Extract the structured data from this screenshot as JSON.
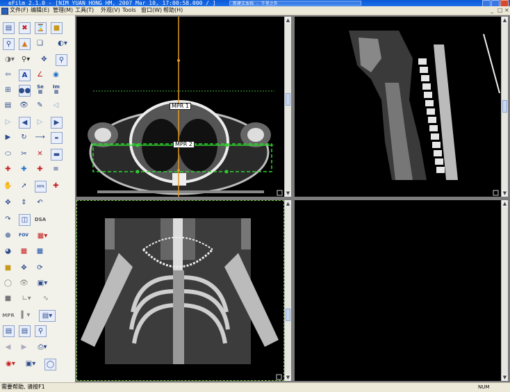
{
  "window": {
    "title": "eFilm 2.1.0 - [NIM YUAN HONG HM, 2007 Mar 10, 17:00:58.000 / ]",
    "taskbar_item": "新建文本档 - 千里之外"
  },
  "menu": {
    "items": [
      "文件(F)",
      "编辑(E)",
      "管理(M)",
      "工具(T)",
      "外观(V)",
      "Tools",
      "窗口(W)",
      "帮助(H)"
    ]
  },
  "toolbar": {
    "text_labels": {
      "series": "Se",
      "image": "Im",
      "fov": "FOV",
      "dsa": "DSA",
      "mpr": "MPR"
    }
  },
  "viewer": {
    "mpr_labels": [
      "MPR 1",
      "MPR 2"
    ]
  },
  "status": {
    "help_text": "需要帮助, 请按F1",
    "mode_indicator": "NUM"
  }
}
